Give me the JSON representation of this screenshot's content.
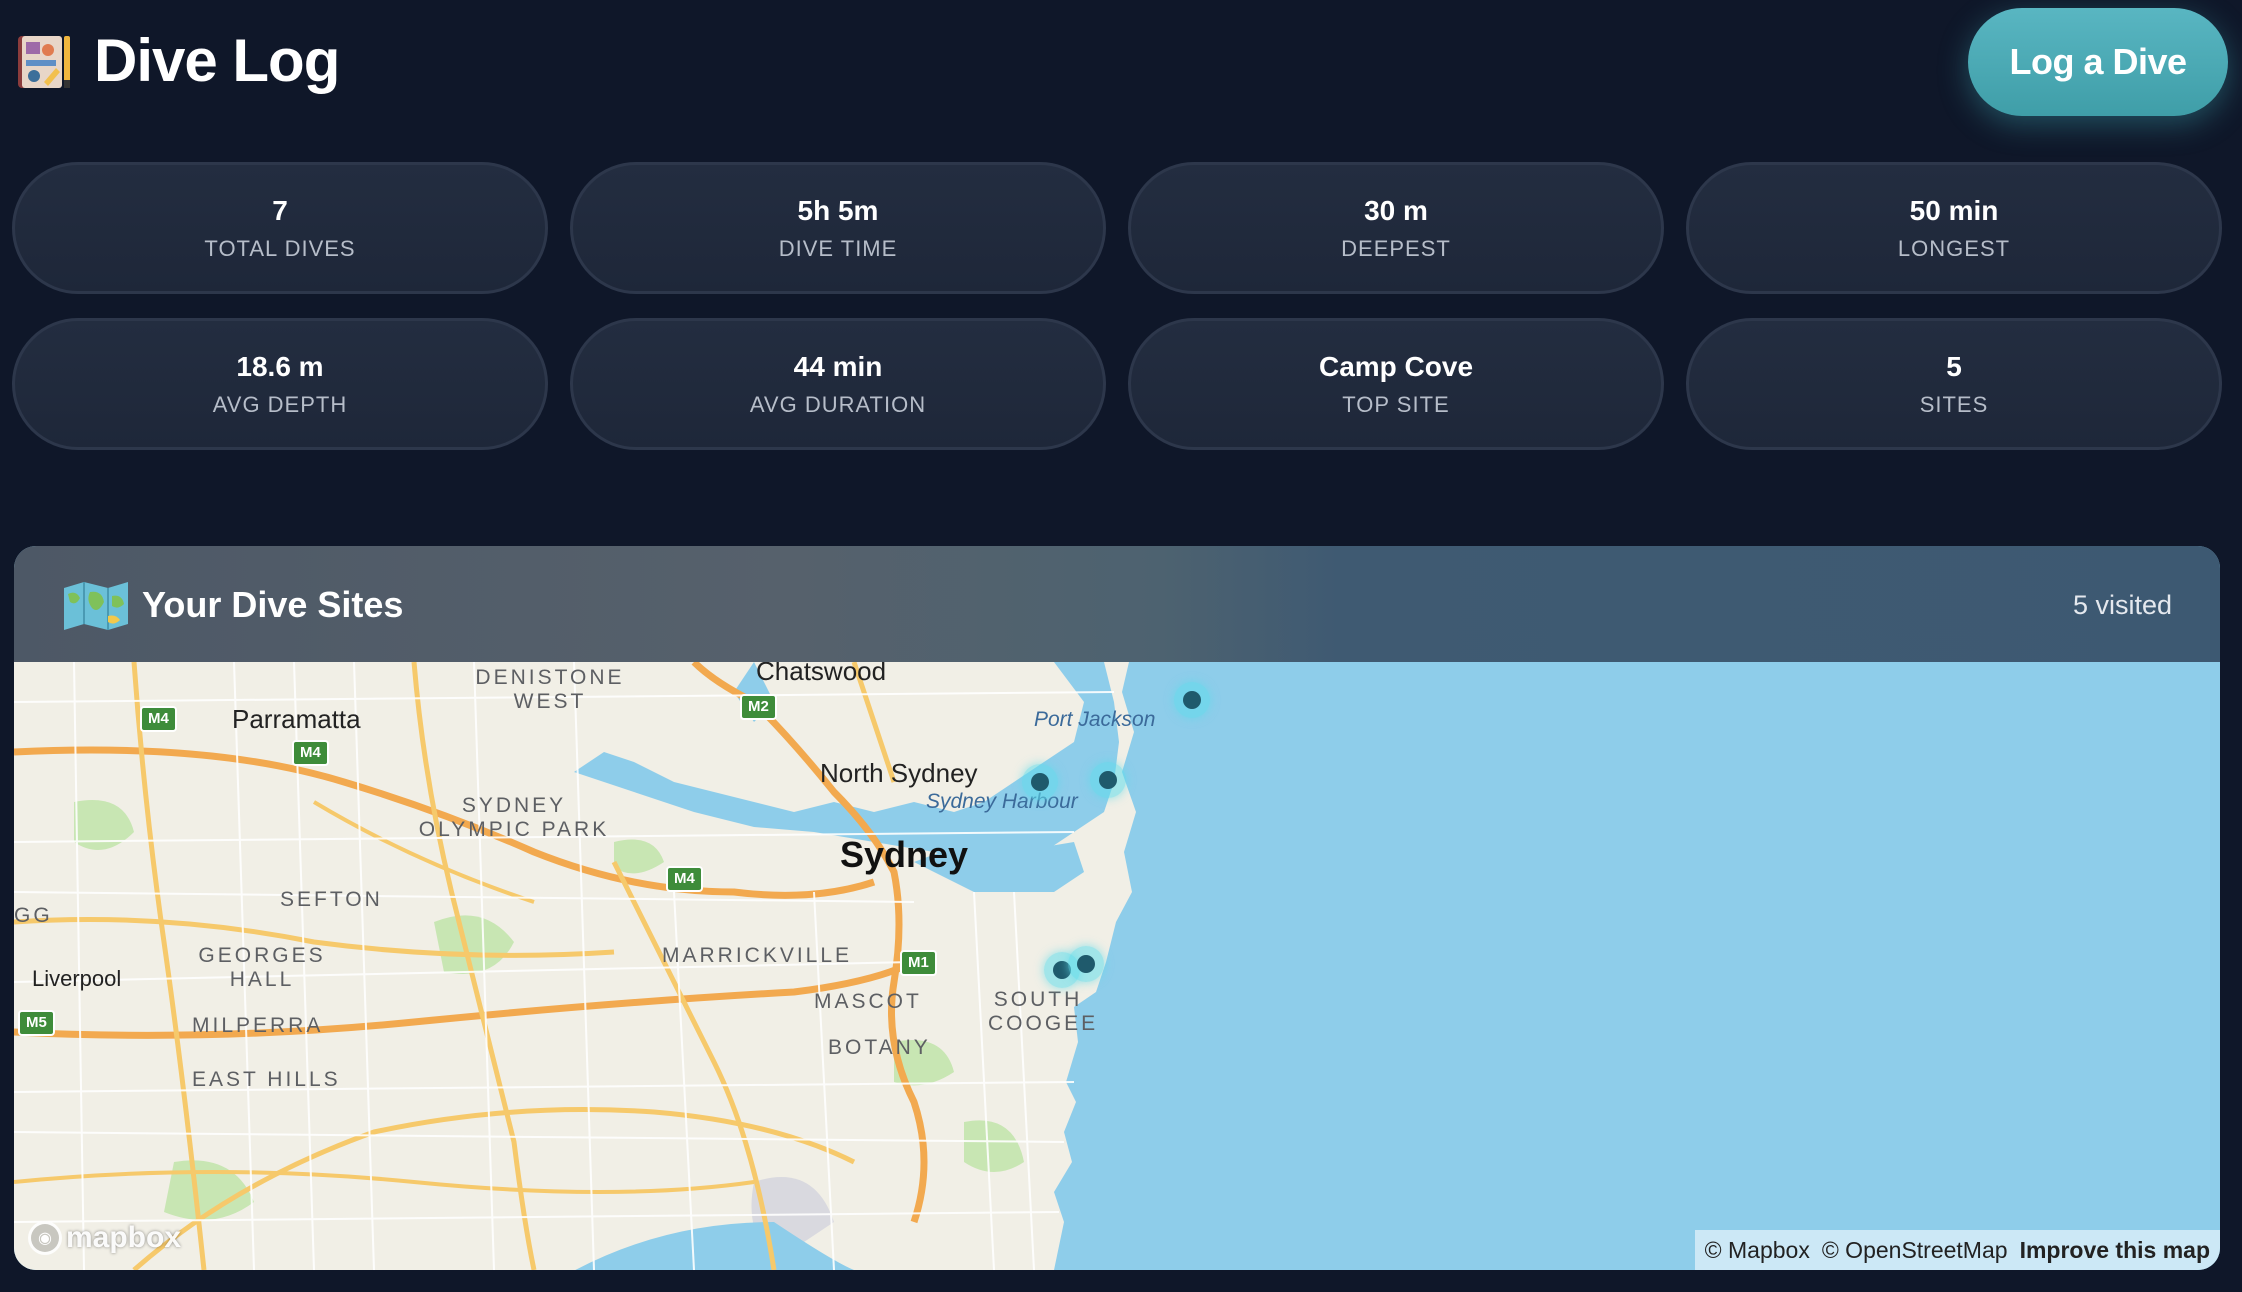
{
  "header": {
    "logo_icon": "dive-logbook-icon",
    "title": "Dive Log",
    "log_button_label": "Log a Dive"
  },
  "stats": [
    {
      "value": "7",
      "label": "TOTAL DIVES"
    },
    {
      "value": "5h 5m",
      "label": "DIVE TIME"
    },
    {
      "value": "30 m",
      "label": "DEEPEST"
    },
    {
      "value": "50 min",
      "label": "LONGEST"
    },
    {
      "value": "18.6 m",
      "label": "AVG DEPTH"
    },
    {
      "value": "44 min",
      "label": "AVG DURATION"
    },
    {
      "value": "Camp Cove",
      "label": "TOP SITE"
    },
    {
      "value": "5",
      "label": "SITES"
    }
  ],
  "map": {
    "icon": "world-map-icon",
    "title": "Your Dive Sites",
    "visited": "5 visited",
    "labels": {
      "chatswood": "Chatswood",
      "denistone_west": "DENISTONE WEST",
      "parramatta": "Parramatta",
      "port_jackson": "Port Jackson",
      "north_sydney": "North Sydney",
      "sydney_olympic_park": "SYDNEY OLYMPIC PARK",
      "sydney_harbour": "Sydney Harbour",
      "sydney": "Sydney",
      "sefton": "SEFTON",
      "gg": "GG",
      "georges_hall": "GEORGES HALL",
      "marrickville": "MARRICKVILLE",
      "liverpool": "Liverpool",
      "mascot": "MASCOT",
      "south_coogee": "SOUTH COOGEE",
      "milperra": "MILPERRA",
      "botany": "BOTANY",
      "east_hills": "EAST HILLS"
    },
    "shields": {
      "m4_a": "M4",
      "m2": "M2",
      "m4_b": "M4",
      "m4_c": "M4",
      "m1": "M1",
      "m5": "M5"
    },
    "logo_text": "mapbox",
    "attribution": {
      "mapbox": "© Mapbox",
      "osm": "© OpenStreetMap",
      "improve": "Improve this map"
    }
  },
  "colors": {
    "background": "#0f1729",
    "accent": "#4fb0bb",
    "card": "#222c3f",
    "ocean": "#8ecdea",
    "land": "#f1efe6",
    "marker": "#5fdceb"
  }
}
